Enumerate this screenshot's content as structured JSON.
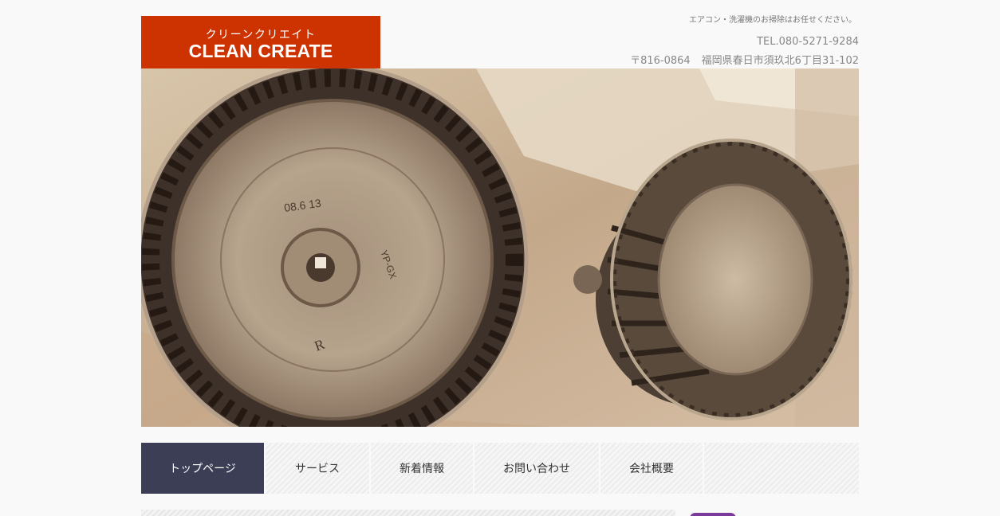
{
  "header": {
    "logo_kana": "クリーンクリエイト",
    "logo_en": "CLEAN CREATE",
    "tagline": "エアコン・洗濯機のお掃除はお任せください。",
    "tel": "TEL.080-5271-9284",
    "zip": "〒816-0864",
    "address": "福岡県春日市須玖北6丁目31-102"
  },
  "nav": {
    "items": [
      {
        "label": "トップページ"
      },
      {
        "label": "サービス"
      },
      {
        "label": "新着情報"
      },
      {
        "label": "お問い合わせ"
      },
      {
        "label": "会社概要"
      }
    ]
  },
  "colors": {
    "brand": "#cc3300",
    "nav_active": "#3b3e55",
    "background": "#f9f9f9",
    "header_text": "#888888"
  }
}
